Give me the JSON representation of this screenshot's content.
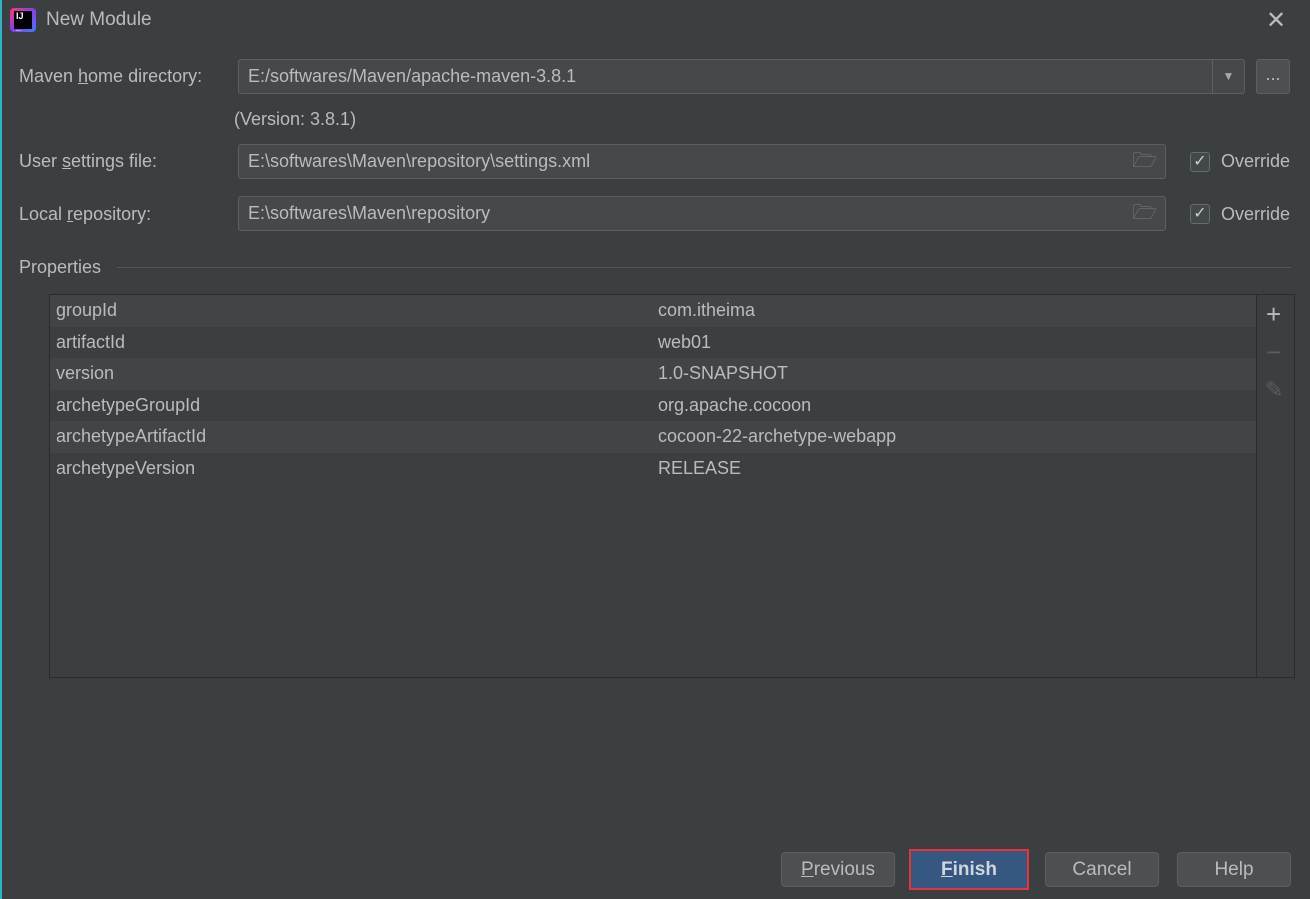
{
  "window": {
    "title": "New Module"
  },
  "maven_home": {
    "label_pre": "Maven ",
    "label_mn": "h",
    "label_post": "ome directory:",
    "value": "E:/softwares/Maven/apache-maven-3.8.1",
    "version": "(Version: 3.8.1)",
    "browse": "..."
  },
  "user_settings": {
    "label_pre": "User ",
    "label_mn": "s",
    "label_post": "ettings file:",
    "value": "E:\\softwares\\Maven\\repository\\settings.xml",
    "override": "Override",
    "checked": true
  },
  "local_repo": {
    "label_pre": "Local ",
    "label_mn": "r",
    "label_post": "epository:",
    "value": "E:\\softwares\\Maven\\repository",
    "override": "Override",
    "checked": true
  },
  "properties": {
    "title": "Properties",
    "rows": [
      {
        "key": "groupId",
        "value": "com.itheima"
      },
      {
        "key": "artifactId",
        "value": "web01"
      },
      {
        "key": "version",
        "value": "1.0-SNAPSHOT"
      },
      {
        "key": "archetypeGroupId",
        "value": "org.apache.cocoon"
      },
      {
        "key": "archetypeArtifactId",
        "value": "cocoon-22-archetype-webapp"
      },
      {
        "key": "archetypeVersion",
        "value": "RELEASE"
      }
    ]
  },
  "buttons": {
    "previous_mn": "P",
    "previous_rest": "revious",
    "finish_mn": "F",
    "finish_rest": "inish",
    "cancel": "Cancel",
    "help": "Help"
  },
  "colors": {
    "accent": "#365880",
    "highlight": "#e8323c"
  }
}
